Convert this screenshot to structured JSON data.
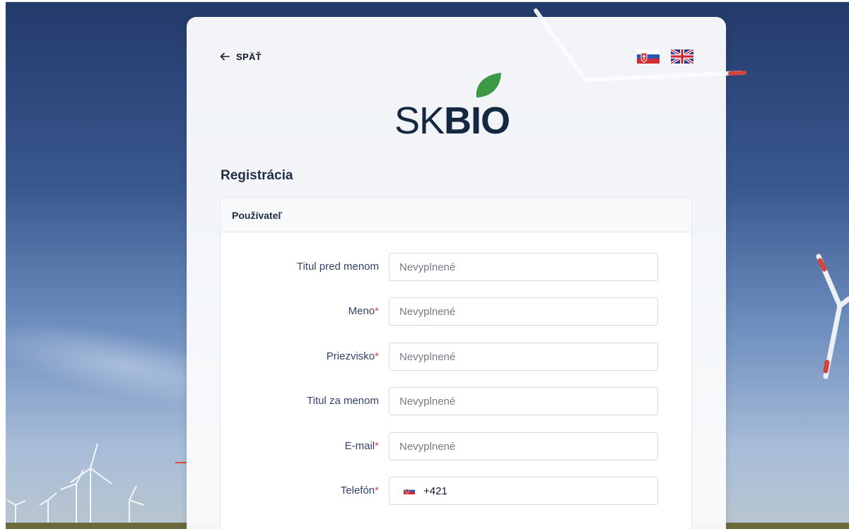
{
  "header": {
    "back_label": "SPÄŤ",
    "languages": [
      {
        "code": "sk",
        "icon": "slovak-flag-icon"
      },
      {
        "code": "en",
        "icon": "uk-flag-icon"
      }
    ]
  },
  "logo": {
    "part1": "SK",
    "part2": "BIO",
    "leaf_color": "#3c9a47",
    "text_color": "#162742"
  },
  "form": {
    "title": "Registrácia",
    "section_title": "Používateľ",
    "required_marker": "*",
    "fields": [
      {
        "label": "Titul pred menom",
        "required": false,
        "placeholder": "Nevyplnené",
        "value": ""
      },
      {
        "label": "Meno",
        "required": true,
        "placeholder": "Nevyplnené",
        "value": ""
      },
      {
        "label": "Priezvisko",
        "required": true,
        "placeholder": "Nevyplnené",
        "value": ""
      },
      {
        "label": "Titul za menom",
        "required": false,
        "placeholder": "Nevyplnené",
        "value": ""
      },
      {
        "label": "E-mail",
        "required": true,
        "placeholder": "Nevyplnené",
        "value": ""
      }
    ],
    "phone": {
      "label": "Telefón",
      "required": true,
      "country_icon": "slovak-flag-icon",
      "value": "+421"
    }
  },
  "colors": {
    "accent_required": "#e0454f",
    "label": "#34426b",
    "heading": "#1f2d45"
  }
}
